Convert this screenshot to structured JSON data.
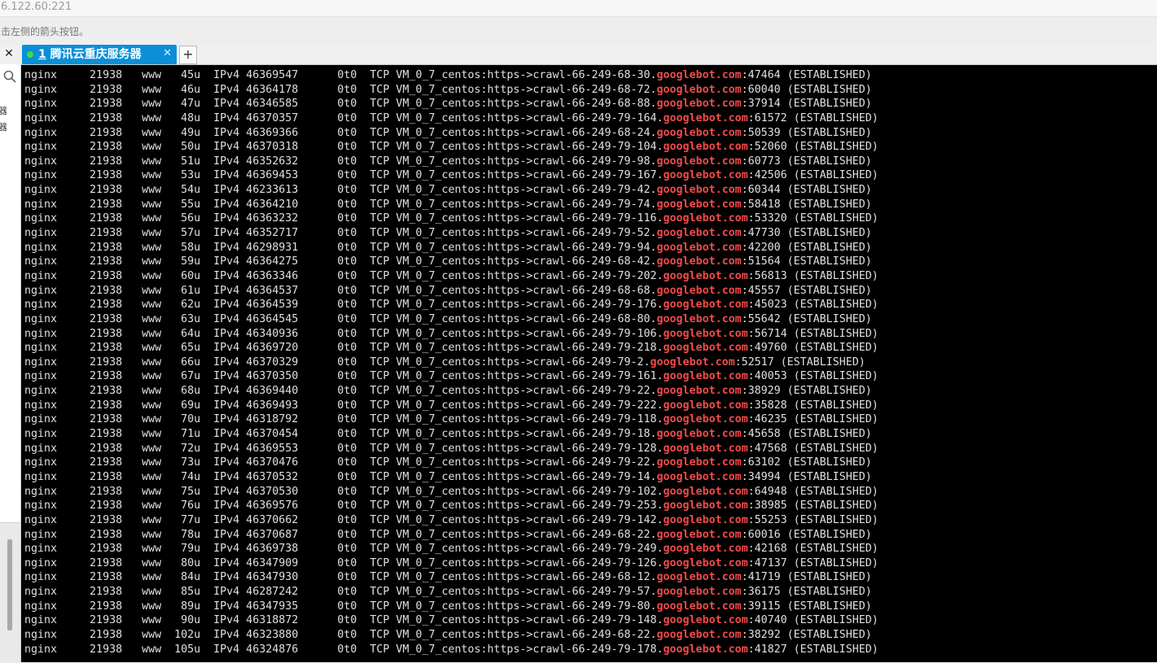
{
  "window": {
    "address": "6.122.60:221",
    "hint": "击左侧的箭头按钮。"
  },
  "tabs": {
    "close_pane": "✕",
    "active_tab": {
      "number": "1",
      "title": "腾讯云重庆服务器",
      "close": "✕"
    },
    "add": "+"
  },
  "left_panel": {
    "chars": "器器"
  },
  "colors": {
    "highlight": "#f24b4b",
    "tab_bg": "#0a8fd8",
    "terminal_bg": "#000000"
  },
  "terminal": {
    "command": "nginx",
    "pid": "21938",
    "user": "www",
    "type": "IPv4",
    "size": "0t0",
    "proto": "TCP",
    "local": "VM_0_7_centos:https->crawl-",
    "highlight": "googlebot.com",
    "state": "(ESTABLISHED)",
    "rows": [
      {
        "fd": "45u",
        "device": "46369547",
        "host": "66-249-68-30.",
        "port": "47464"
      },
      {
        "fd": "46u",
        "device": "46364178",
        "host": "66-249-68-72.",
        "port": "60040"
      },
      {
        "fd": "47u",
        "device": "46346585",
        "host": "66-249-68-88.",
        "port": "37914"
      },
      {
        "fd": "48u",
        "device": "46370357",
        "host": "66-249-79-164.",
        "port": "61572"
      },
      {
        "fd": "49u",
        "device": "46369366",
        "host": "66-249-68-24.",
        "port": "50539"
      },
      {
        "fd": "50u",
        "device": "46370318",
        "host": "66-249-79-104.",
        "port": "52060"
      },
      {
        "fd": "51u",
        "device": "46352632",
        "host": "66-249-79-98.",
        "port": "60773"
      },
      {
        "fd": "53u",
        "device": "46369453",
        "host": "66-249-79-167.",
        "port": "42506"
      },
      {
        "fd": "54u",
        "device": "46233613",
        "host": "66-249-79-42.",
        "port": "60344"
      },
      {
        "fd": "55u",
        "device": "46364210",
        "host": "66-249-79-74.",
        "port": "58418"
      },
      {
        "fd": "56u",
        "device": "46363232",
        "host": "66-249-79-116.",
        "port": "53320"
      },
      {
        "fd": "57u",
        "device": "46352717",
        "host": "66-249-79-52.",
        "port": "47730"
      },
      {
        "fd": "58u",
        "device": "46298931",
        "host": "66-249-79-94.",
        "port": "42200"
      },
      {
        "fd": "59u",
        "device": "46364275",
        "host": "66-249-68-42.",
        "port": "51564"
      },
      {
        "fd": "60u",
        "device": "46363346",
        "host": "66-249-79-202.",
        "port": "56813"
      },
      {
        "fd": "61u",
        "device": "46364537",
        "host": "66-249-68-68.",
        "port": "45557"
      },
      {
        "fd": "62u",
        "device": "46364539",
        "host": "66-249-79-176.",
        "port": "45023"
      },
      {
        "fd": "63u",
        "device": "46364545",
        "host": "66-249-68-80.",
        "port": "55642"
      },
      {
        "fd": "64u",
        "device": "46340936",
        "host": "66-249-79-106.",
        "port": "56714"
      },
      {
        "fd": "65u",
        "device": "46369720",
        "host": "66-249-79-218.",
        "port": "49760"
      },
      {
        "fd": "66u",
        "device": "46370329",
        "host": "66-249-79-2.",
        "port": "52517"
      },
      {
        "fd": "67u",
        "device": "46370350",
        "host": "66-249-79-161.",
        "port": "40053"
      },
      {
        "fd": "68u",
        "device": "46369440",
        "host": "66-249-79-22.",
        "port": "38929"
      },
      {
        "fd": "69u",
        "device": "46369493",
        "host": "66-249-79-222.",
        "port": "35828"
      },
      {
        "fd": "70u",
        "device": "46318792",
        "host": "66-249-79-118.",
        "port": "46235"
      },
      {
        "fd": "71u",
        "device": "46370454",
        "host": "66-249-79-18.",
        "port": "45658"
      },
      {
        "fd": "72u",
        "device": "46369553",
        "host": "66-249-79-128.",
        "port": "47568"
      },
      {
        "fd": "73u",
        "device": "46370476",
        "host": "66-249-79-22.",
        "port": "63102"
      },
      {
        "fd": "74u",
        "device": "46370532",
        "host": "66-249-79-14.",
        "port": "34994"
      },
      {
        "fd": "75u",
        "device": "46370530",
        "host": "66-249-79-102.",
        "port": "64948"
      },
      {
        "fd": "76u",
        "device": "46369576",
        "host": "66-249-79-253.",
        "port": "38985"
      },
      {
        "fd": "77u",
        "device": "46370662",
        "host": "66-249-79-142.",
        "port": "55253"
      },
      {
        "fd": "78u",
        "device": "46370687",
        "host": "66-249-68-22.",
        "port": "60016"
      },
      {
        "fd": "79u",
        "device": "46369738",
        "host": "66-249-79-249.",
        "port": "42168"
      },
      {
        "fd": "80u",
        "device": "46347909",
        "host": "66-249-79-126.",
        "port": "47137"
      },
      {
        "fd": "84u",
        "device": "46347930",
        "host": "66-249-68-12.",
        "port": "41719"
      },
      {
        "fd": "85u",
        "device": "46287242",
        "host": "66-249-79-57.",
        "port": "36175"
      },
      {
        "fd": "89u",
        "device": "46347935",
        "host": "66-249-79-80.",
        "port": "39115"
      },
      {
        "fd": "90u",
        "device": "46318872",
        "host": "66-249-79-148.",
        "port": "40740"
      },
      {
        "fd": "102u",
        "device": "46323880",
        "host": "66-249-68-22.",
        "port": "38292"
      },
      {
        "fd": "105u",
        "device": "46324876",
        "host": "66-249-79-178.",
        "port": "41827"
      }
    ]
  }
}
